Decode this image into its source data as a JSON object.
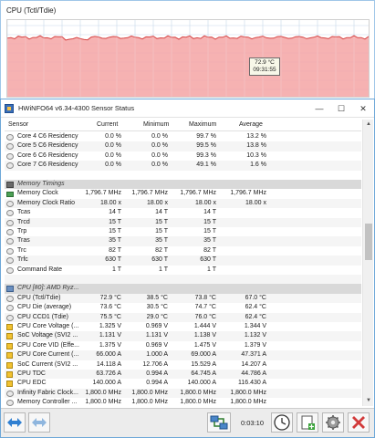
{
  "graph": {
    "title": "CPU (Tctl/Tdie)",
    "tooltip_value": "72.9 °C",
    "tooltip_time": "09:31:55",
    "fill_color": "#f4a4a4",
    "line_color": "#d64545",
    "grid_color": "#c7d8ea"
  },
  "window": {
    "title": "HWiNFO64 v6.34-4300 Sensor Status",
    "minimize_glyph": "—",
    "maximize_glyph": "☐",
    "close_glyph": "✕"
  },
  "columns": {
    "sensor": "Sensor",
    "current": "Current",
    "minimum": "Minimum",
    "maximum": "Maximum",
    "average": "Average"
  },
  "rows": [
    {
      "kind": "item",
      "icon": "circle",
      "name": "Core 4 C6 Residency",
      "cur": "0.0 %",
      "min": "0.0 %",
      "max": "99.7 %",
      "avg": "13.2 %"
    },
    {
      "kind": "item",
      "icon": "circle",
      "name": "Core 5 C6 Residency",
      "cur": "0.0 %",
      "min": "0.0 %",
      "max": "99.5 %",
      "avg": "13.8 %"
    },
    {
      "kind": "item",
      "icon": "circle",
      "name": "Core 6 C6 Residency",
      "cur": "0.0 %",
      "min": "0.0 %",
      "max": "99.3 %",
      "avg": "10.3 %"
    },
    {
      "kind": "item",
      "icon": "circle",
      "name": "Core 7 C6 Residency",
      "cur": "0.0 %",
      "min": "0.0 %",
      "max": "49.1 %",
      "avg": "1.6 %"
    },
    {
      "kind": "blank"
    },
    {
      "kind": "group",
      "icon": "grp-mem",
      "name": "Memory Timings"
    },
    {
      "kind": "item",
      "icon": "mem",
      "name": "Memory Clock",
      "cur": "1,796.7 MHz",
      "min": "1,796.7 MHz",
      "max": "1,796.7 MHz",
      "avg": "1,796.7 MHz"
    },
    {
      "kind": "item",
      "icon": "circle",
      "name": "Memory Clock Ratio",
      "cur": "18.00 x",
      "min": "18.00 x",
      "max": "18.00 x",
      "avg": "18.00 x"
    },
    {
      "kind": "item",
      "icon": "circle",
      "name": "Tcas",
      "cur": "14 T",
      "min": "14 T",
      "max": "14 T",
      "avg": ""
    },
    {
      "kind": "item",
      "icon": "circle",
      "name": "Trcd",
      "cur": "15 T",
      "min": "15 T",
      "max": "15 T",
      "avg": ""
    },
    {
      "kind": "item",
      "icon": "circle",
      "name": "Trp",
      "cur": "15 T",
      "min": "15 T",
      "max": "15 T",
      "avg": ""
    },
    {
      "kind": "item",
      "icon": "circle",
      "name": "Tras",
      "cur": "35 T",
      "min": "35 T",
      "max": "35 T",
      "avg": ""
    },
    {
      "kind": "item",
      "icon": "circle",
      "name": "Trc",
      "cur": "82 T",
      "min": "82 T",
      "max": "82 T",
      "avg": ""
    },
    {
      "kind": "item",
      "icon": "circle",
      "name": "Trfc",
      "cur": "630 T",
      "min": "630 T",
      "max": "630 T",
      "avg": ""
    },
    {
      "kind": "item",
      "icon": "circle",
      "name": "Command Rate",
      "cur": "1 T",
      "min": "1 T",
      "max": "1 T",
      "avg": ""
    },
    {
      "kind": "blank"
    },
    {
      "kind": "group",
      "icon": "grp-cpu",
      "name": "CPU [#0]: AMD Ryz..."
    },
    {
      "kind": "item",
      "icon": "circle",
      "name": "CPU (Tctl/Tdie)",
      "cur": "72.9 °C",
      "min": "38.5 °C",
      "max": "73.8 °C",
      "avg": "67.0 °C"
    },
    {
      "kind": "item",
      "icon": "circle",
      "name": "CPU Die (average)",
      "cur": "73.6 °C",
      "min": "30.5 °C",
      "max": "74.7 °C",
      "avg": "62.4 °C"
    },
    {
      "kind": "item",
      "icon": "circle",
      "name": "CPU CCD1 (Tdie)",
      "cur": "75.5 °C",
      "min": "29.0 °C",
      "max": "76.0 °C",
      "avg": "62.4 °C"
    },
    {
      "kind": "item",
      "icon": "cpu",
      "name": "CPU Core Voltage (...",
      "cur": "1.325 V",
      "min": "0.969 V",
      "max": "1.444 V",
      "avg": "1.344 V"
    },
    {
      "kind": "item",
      "icon": "cpu",
      "name": "SoC Voltage (SVI2 ...",
      "cur": "1.131 V",
      "min": "1.131 V",
      "max": "1.138 V",
      "avg": "1.132 V"
    },
    {
      "kind": "item",
      "icon": "cpu",
      "name": "CPU Core VID (Effe...",
      "cur": "1.375 V",
      "min": "0.969 V",
      "max": "1.475 V",
      "avg": "1.379 V"
    },
    {
      "kind": "item",
      "icon": "cpu",
      "name": "CPU Core Current (...",
      "cur": "66.000 A",
      "min": "1.000 A",
      "max": "69.000 A",
      "avg": "47.371 A"
    },
    {
      "kind": "item",
      "icon": "cpu",
      "name": "SoC Current (SVI2 ...",
      "cur": "14.118 A",
      "min": "12.706 A",
      "max": "15.529 A",
      "avg": "14.207 A"
    },
    {
      "kind": "item",
      "icon": "cpu",
      "name": "CPU TDC",
      "cur": "63.726 A",
      "min": "0.994 A",
      "max": "64.745 A",
      "avg": "44.786 A"
    },
    {
      "kind": "item",
      "icon": "cpu",
      "name": "CPU EDC",
      "cur": "140.000 A",
      "min": "0.994 A",
      "max": "140.000 A",
      "avg": "116.430 A"
    },
    {
      "kind": "item",
      "icon": "circle",
      "name": "Infinity Fabric Clock...",
      "cur": "1,800.0 MHz",
      "min": "1,800.0 MHz",
      "max": "1,800.0 MHz",
      "avg": "1,800.0 MHz"
    },
    {
      "kind": "item",
      "icon": "circle",
      "name": "Memory Controller ...",
      "cur": "1,800.0 MHz",
      "min": "1,800.0 MHz",
      "max": "1,800.0 MHz",
      "avg": "1,800.0 MHz"
    }
  ],
  "toolbar": {
    "elapsed": "0:03:10"
  }
}
